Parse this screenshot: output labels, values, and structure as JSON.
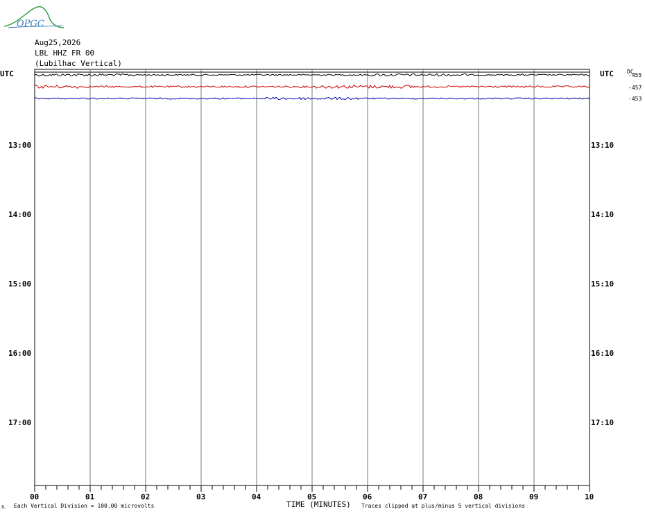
{
  "logo": {
    "text": "OPGC",
    "brand_color": "#3a7fc1",
    "swoosh_color": "#3aa046"
  },
  "header": {
    "date": "Aug25,2026",
    "station": "LBL HHZ FR 00",
    "location": "(Lubilhac Vertical)"
  },
  "axes": {
    "left_label": "UTC",
    "right_label": "UTC",
    "left_rows": [
      "13:00",
      "14:00",
      "15:00",
      "16:00",
      "17:00"
    ],
    "right_rows": [
      "13:10",
      "14:10",
      "15:10",
      "16:10",
      "17:10"
    ],
    "x_ticks": [
      "00",
      "01",
      "02",
      "03",
      "04",
      "05",
      "06",
      "07",
      "08",
      "09",
      "10"
    ],
    "x_label": "TIME (MINUTES)"
  },
  "dc": {
    "label": "DC",
    "values": [
      "-455",
      "-457",
      "-453"
    ]
  },
  "footer": {
    "left_mark": "JL",
    "division": "Each Vertical Division =  100.00 microvolts",
    "clip_note": "Traces clipped at plus/minus 5 vertical divisions"
  },
  "chart_data": {
    "type": "line",
    "xlabel": "TIME (MINUTES)",
    "xlim": [
      0,
      10
    ],
    "rows_per_hour": 6,
    "traces": [
      {
        "color": "#000000",
        "dc": -455,
        "amplitude": 1.0
      },
      {
        "color": "#cc0000",
        "dc": -457,
        "amplitude": 1.3
      },
      {
        "color": "#0000aa",
        "dc": -453,
        "amplitude": 1.0
      }
    ],
    "grid": true
  }
}
